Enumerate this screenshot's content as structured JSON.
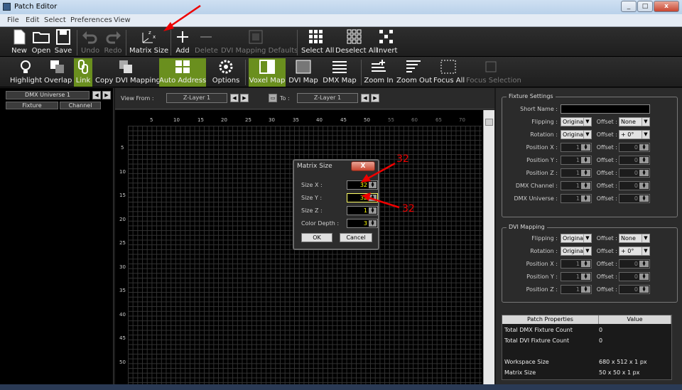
{
  "window": {
    "title": "Patch Editor"
  },
  "menu": [
    "File",
    "Edit",
    "Select",
    "Preferences",
    "View"
  ],
  "toolbar1": {
    "new": "New",
    "open": "Open",
    "save": "Save",
    "undo": "Undo",
    "redo": "Redo",
    "matrix_size": "Matrix Size",
    "add": "Add",
    "delete": "Delete",
    "dvi_defaults": "DVI Mapping Defaults",
    "select_all": "Select All",
    "deselect_all": "Deselect All",
    "invert": "Invert"
  },
  "toolbar2": {
    "highlight": "Highlight",
    "overlap": "Overlap",
    "link": "Link",
    "copy_dvi": "Copy DVI Mapping",
    "auto_address": "Auto Address",
    "options": "Options",
    "voxel_map": "Voxel Map",
    "dvi_map": "DVI Map",
    "dmx_map": "DMX Map",
    "zoom_in": "Zoom In",
    "zoom_out": "Zoom Out",
    "focus_all": "Focus All",
    "focus_selection": "Focus Selection"
  },
  "left_panel": {
    "universe": "DMX Universe 1",
    "col_fixture": "Fixture",
    "col_channel": "Channel"
  },
  "view": {
    "view_from_label": "View From :",
    "view_from_value": "Z-Layer 1",
    "to_label": "To :",
    "to_value": "Z-Layer 1"
  },
  "ruler": {
    "x": [
      "5",
      "10",
      "15",
      "20",
      "25",
      "30",
      "35",
      "40",
      "45",
      "50",
      "55",
      "60",
      "65",
      "70"
    ],
    "y": [
      "5",
      "10",
      "15",
      "20",
      "25",
      "30",
      "35",
      "40",
      "45",
      "50"
    ]
  },
  "fixture_settings": {
    "title": "Fixture Settings",
    "short_name_label": "Short Name :",
    "flipping_label": "Flipping :",
    "flipping_value": "Original",
    "offset_label": "Offset :",
    "offset_flip_value": "None",
    "rotation_label": "Rotation :",
    "rotation_value": "Original",
    "offset_rot_value": "+ 0°",
    "position_x_label": "Position X :",
    "position_y_label": "Position Y :",
    "position_z_label": "Position Z :",
    "dmx_channel_label": "DMX Channel :",
    "dmx_universe_label": "DMX Universe :",
    "pos_x": "1",
    "pos_y": "1",
    "pos_z": "1",
    "dmx_channel": "1",
    "dmx_universe": "1",
    "off_x": "0",
    "off_y": "0",
    "off_z": "0",
    "off_ch": "0",
    "off_un": "0"
  },
  "dvi_mapping": {
    "title": "DVI Mapping",
    "flipping_label": "Flipping :",
    "flipping_value": "Original",
    "offset_label": "Offset :",
    "offset_flip_value": "None",
    "rotation_label": "Rotation :",
    "rotation_value": "Original",
    "offset_rot_value": "+ 0°",
    "position_x_label": "Position X :",
    "position_y_label": "Position Y :",
    "position_z_label": "Position Z :",
    "pos_x": "1",
    "pos_y": "1",
    "pos_z": "1",
    "off_x": "0",
    "off_y": "0",
    "off_z": "0"
  },
  "patch_properties": {
    "col_name": "Patch Properties",
    "col_value": "Value",
    "rows": [
      {
        "name": "Total DMX Fixture Count",
        "value": "0"
      },
      {
        "name": "Total DVI Fixture Count",
        "value": "0"
      },
      {
        "name": "Workspace Size",
        "value": "680 x 512 x 1 px"
      },
      {
        "name": "Matrix Size",
        "value": "50 x 50 x 1 px"
      }
    ]
  },
  "dialog": {
    "title": "Matrix Size",
    "close": "X",
    "size_x_label": "Size X :",
    "size_x": "32",
    "size_y_label": "Size Y :",
    "size_y": "32",
    "size_z_label": "Size Z :",
    "size_z": "1",
    "color_depth_label": "Color Depth :",
    "color_depth": "3",
    "ok": "OK",
    "cancel": "Cancel"
  },
  "annotations": {
    "a1": "32",
    "a2": "32",
    "color": "#e00000"
  }
}
